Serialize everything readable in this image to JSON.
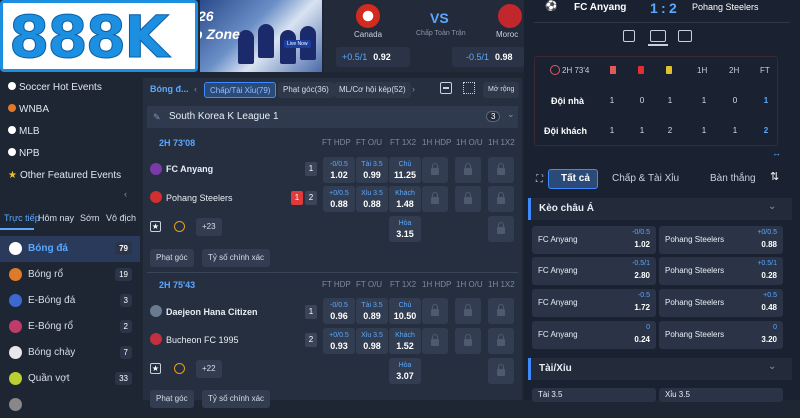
{
  "logo": {
    "text": "888K"
  },
  "banner": {
    "line1": "26",
    "line2": "p Zone",
    "badge": "Live Now"
  },
  "top_match": {
    "home": "Canada",
    "away": "Moroc",
    "vs": "VS",
    "sub": "Chấp Toàn Trận",
    "h1": "+0.5/1",
    "o1": "0.92",
    "h2": "-0.5/1",
    "o2": "0.98"
  },
  "score": {
    "home": "FC Anyang",
    "away": "Pohang Steelers",
    "sh": "1",
    "sep": ":",
    "sa": "2",
    "time": "2H 73'4",
    "cols": [
      "1H",
      "2H",
      "FT"
    ],
    "rows": [
      {
        "label": "Đội nhà",
        "v": [
          "1",
          "0",
          "1",
          "1",
          "0",
          "1"
        ]
      },
      {
        "label": "Đội khách",
        "v": [
          "1",
          "1",
          "2",
          "1",
          "1",
          "2"
        ]
      }
    ]
  },
  "sidebar": {
    "items": [
      "Soccer Hot Events",
      "WNBA",
      "MLB",
      "NPB",
      "Other Featured Events"
    ],
    "tabs": [
      "Trực tiếp",
      "Hôm nay",
      "Sớm",
      "Vô địch"
    ],
    "sports": [
      {
        "name": "Bóng đá",
        "count": "79"
      },
      {
        "name": "Bóng rổ",
        "count": "19"
      },
      {
        "name": "E-Bóng đá",
        "count": "3"
      },
      {
        "name": "E-Bóng rổ",
        "count": "2"
      },
      {
        "name": "Bóng chày",
        "count": "7"
      },
      {
        "name": "Quần vợt",
        "count": "33"
      }
    ]
  },
  "center": {
    "sport_label": "Bóng đ...",
    "chips": [
      "Chấp/Tài Xỉu(79)",
      "Phạt góc(36)",
      "ML/Cơ hội kép(52)"
    ],
    "expand": "Mở rộng",
    "league": "South Korea K League 1",
    "league_count": "3",
    "headers": [
      "FT HDP",
      "FT O/U",
      "FT 1X2",
      "1H HDP",
      "1H O/U",
      "1H 1X2"
    ],
    "matches": [
      {
        "time": "2H 73'08",
        "home": "FC Anyang",
        "away": "Pohang Steelers",
        "hr": "1",
        "ar": "2",
        "red": "1",
        "hdp": [
          [
            "-0/0.5",
            "1.02"
          ],
          [
            "+0/0.5",
            "0.88"
          ]
        ],
        "ou": [
          [
            "Tài 3.5",
            "0.99"
          ],
          [
            "Xỉu 3.5",
            "0.88"
          ]
        ],
        "x12": [
          [
            "Chủ",
            "11.25"
          ],
          [
            "Khách",
            "1.48"
          ],
          [
            "Hòa",
            "3.15"
          ]
        ],
        "more": "+23"
      },
      {
        "time": "2H 75'43",
        "home": "Daejeon Hana Citizen",
        "away": "Bucheon FC 1995",
        "hr": "1",
        "ar": "2",
        "hdp": [
          [
            "-0/0.5",
            "0.96"
          ],
          [
            "+0/0.5",
            "0.93"
          ]
        ],
        "ou": [
          [
            "Tài 3.5",
            "0.89"
          ],
          [
            "Xỉu 3.5",
            "0.98"
          ]
        ],
        "x12": [
          [
            "Chủ",
            "10.50"
          ],
          [
            "Khách",
            "1.52"
          ],
          [
            "Hòa",
            "3.07"
          ]
        ],
        "more": "+22"
      }
    ],
    "btn_corner": "Phạt góc",
    "btn_exact": "Tỷ số chính xác"
  },
  "right": {
    "tabs": [
      "Tất cả",
      "Chấp & Tài Xỉu",
      "Bàn thắng"
    ],
    "sect1": "Kèo châu Á",
    "sect2": "Tài/Xỉu",
    "rows": [
      [
        [
          "FC Anyang",
          "-0/0.5",
          "1.02"
        ],
        [
          "Pohang Steelers",
          "+0/0.5",
          "0.88"
        ]
      ],
      [
        [
          "FC Anyang",
          "-0.5/1",
          "2.80"
        ],
        [
          "Pohang Steelers",
          "+0.5/1",
          "0.28"
        ]
      ],
      [
        [
          "FC Anyang",
          "-0.5",
          "1.72"
        ],
        [
          "Pohang Steelers",
          "+0.5",
          "0.48"
        ]
      ],
      [
        [
          "FC Anyang",
          "0",
          "0.24"
        ],
        [
          "Pohang Steelers",
          "0",
          "3.20"
        ]
      ]
    ],
    "ou_left": "Tài 3.5",
    "ou_right": "Xỉu 3.5"
  }
}
